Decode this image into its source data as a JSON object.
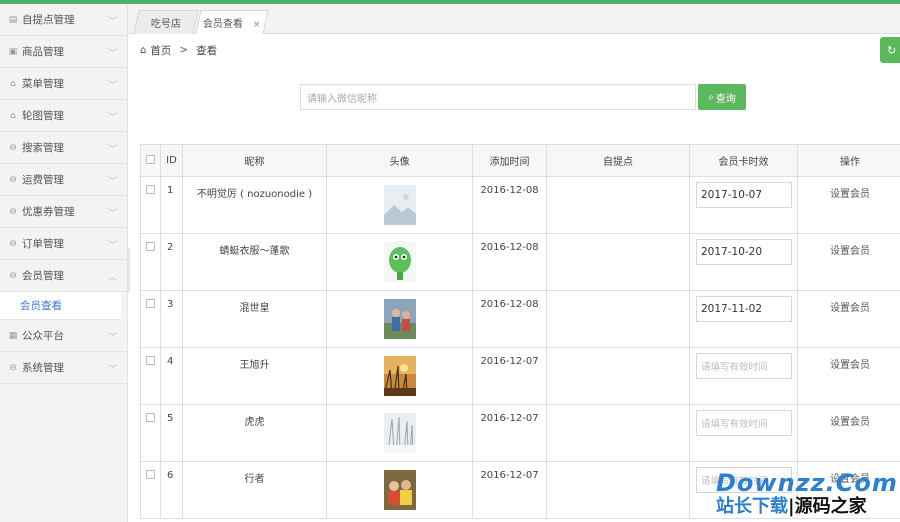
{
  "sidebar": {
    "items": [
      {
        "label": "自提点管理",
        "icon": "document-icon",
        "glyph": "▤"
      },
      {
        "label": "商品管理",
        "icon": "image-icon",
        "glyph": "▣"
      },
      {
        "label": "菜单管理",
        "icon": "lock-icon",
        "glyph": "⌂"
      },
      {
        "label": "轮图管理",
        "icon": "lock-icon",
        "glyph": "⌂"
      },
      {
        "label": "搜索管理",
        "icon": "settings-icon",
        "glyph": "⊖"
      },
      {
        "label": "运费管理",
        "icon": "settings-icon",
        "glyph": "⊖"
      },
      {
        "label": "优惠券管理",
        "icon": "settings-icon",
        "glyph": "⊖"
      },
      {
        "label": "订单管理",
        "icon": "settings-icon",
        "glyph": "⊖"
      },
      {
        "label": "会员管理",
        "icon": "settings-icon",
        "glyph": "⊖"
      }
    ],
    "active_sub": "会员查看",
    "after_items": [
      {
        "label": "公众平台",
        "icon": "grid-icon",
        "glyph": "▦"
      },
      {
        "label": "系统管理",
        "icon": "settings-icon",
        "glyph": "⊖"
      }
    ]
  },
  "tabs": [
    {
      "label": "吃号店"
    },
    {
      "label": "会员查看",
      "close": "×"
    }
  ],
  "breadcrumb": {
    "home": "首页",
    "sep": ">",
    "current": "查看"
  },
  "search": {
    "placeholder": "请输入微信昵称",
    "button": "查询"
  },
  "table": {
    "headers": [
      "ID",
      "昵称",
      "头像",
      "添加时间",
      "自提点",
      "会员卡时效",
      "操作"
    ],
    "rows": [
      {
        "id": "1",
        "nickname": "不明觉厉 ( nozuonodie )",
        "added": "2016-12-08",
        "pickup": "",
        "expiry": "2017-10-07",
        "op": "设置会员"
      },
      {
        "id": "2",
        "nickname": "蜻蜓衣服～蓬歌",
        "added": "2016-12-08",
        "pickup": "",
        "expiry": "2017-10-20",
        "op": "设置会员"
      },
      {
        "id": "3",
        "nickname": "混世皇",
        "added": "2016-12-08",
        "pickup": "",
        "expiry": "2017-11-02",
        "op": "设置会员"
      },
      {
        "id": "4",
        "nickname": "王旭升",
        "added": "2016-12-07",
        "pickup": "",
        "expiry": "",
        "op": "设置会员"
      },
      {
        "id": "5",
        "nickname": "虎虎",
        "added": "2016-12-07",
        "pickup": "",
        "expiry": "",
        "op": "设置会员"
      },
      {
        "id": "6",
        "nickname": "行者",
        "added": "2016-12-07",
        "pickup": "",
        "expiry": "",
        "op": "设置会员"
      }
    ],
    "expiry_placeholder": "请填写有效时间"
  },
  "watermark": {
    "top": "Downzz.Com",
    "bottom_blue": "站长下载",
    "bottom_sep": "|",
    "bottom_black": "源码之家"
  },
  "colors": {
    "accent_green": "#5cb85c",
    "topbar": "#4fae6a",
    "link_blue": "#3a7bd5"
  }
}
